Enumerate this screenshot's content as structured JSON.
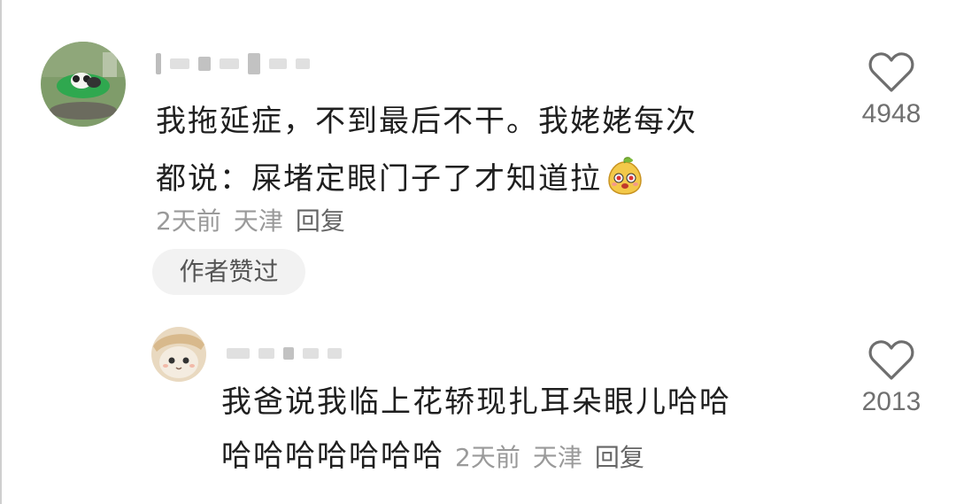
{
  "comments": [
    {
      "text_line1": "我拖延症，不到最后不干。我姥姥每次",
      "text_line2": "都说：屎堵定眼门子了才知道拉",
      "emoji": "smiling-pear-face-sticker",
      "time": "2天前",
      "location": "天津",
      "reply_label": "回复",
      "badge": "作者赞过",
      "likes": "4948",
      "avatar": "panda-on-green-mat-avatar"
    },
    {
      "text_line1": "我爸说我临上花轿现扎耳朵眼儿哈哈",
      "text_line2": "哈哈哈哈哈哈哈",
      "time": "2天前",
      "location": "天津",
      "reply_label": "回复",
      "likes": "2013",
      "avatar": "cat-with-hat-avatar"
    }
  ],
  "colors": {
    "meta": "#9a9a9a",
    "badge_bg": "#f2f2f2",
    "text": "#1f1f1f"
  }
}
